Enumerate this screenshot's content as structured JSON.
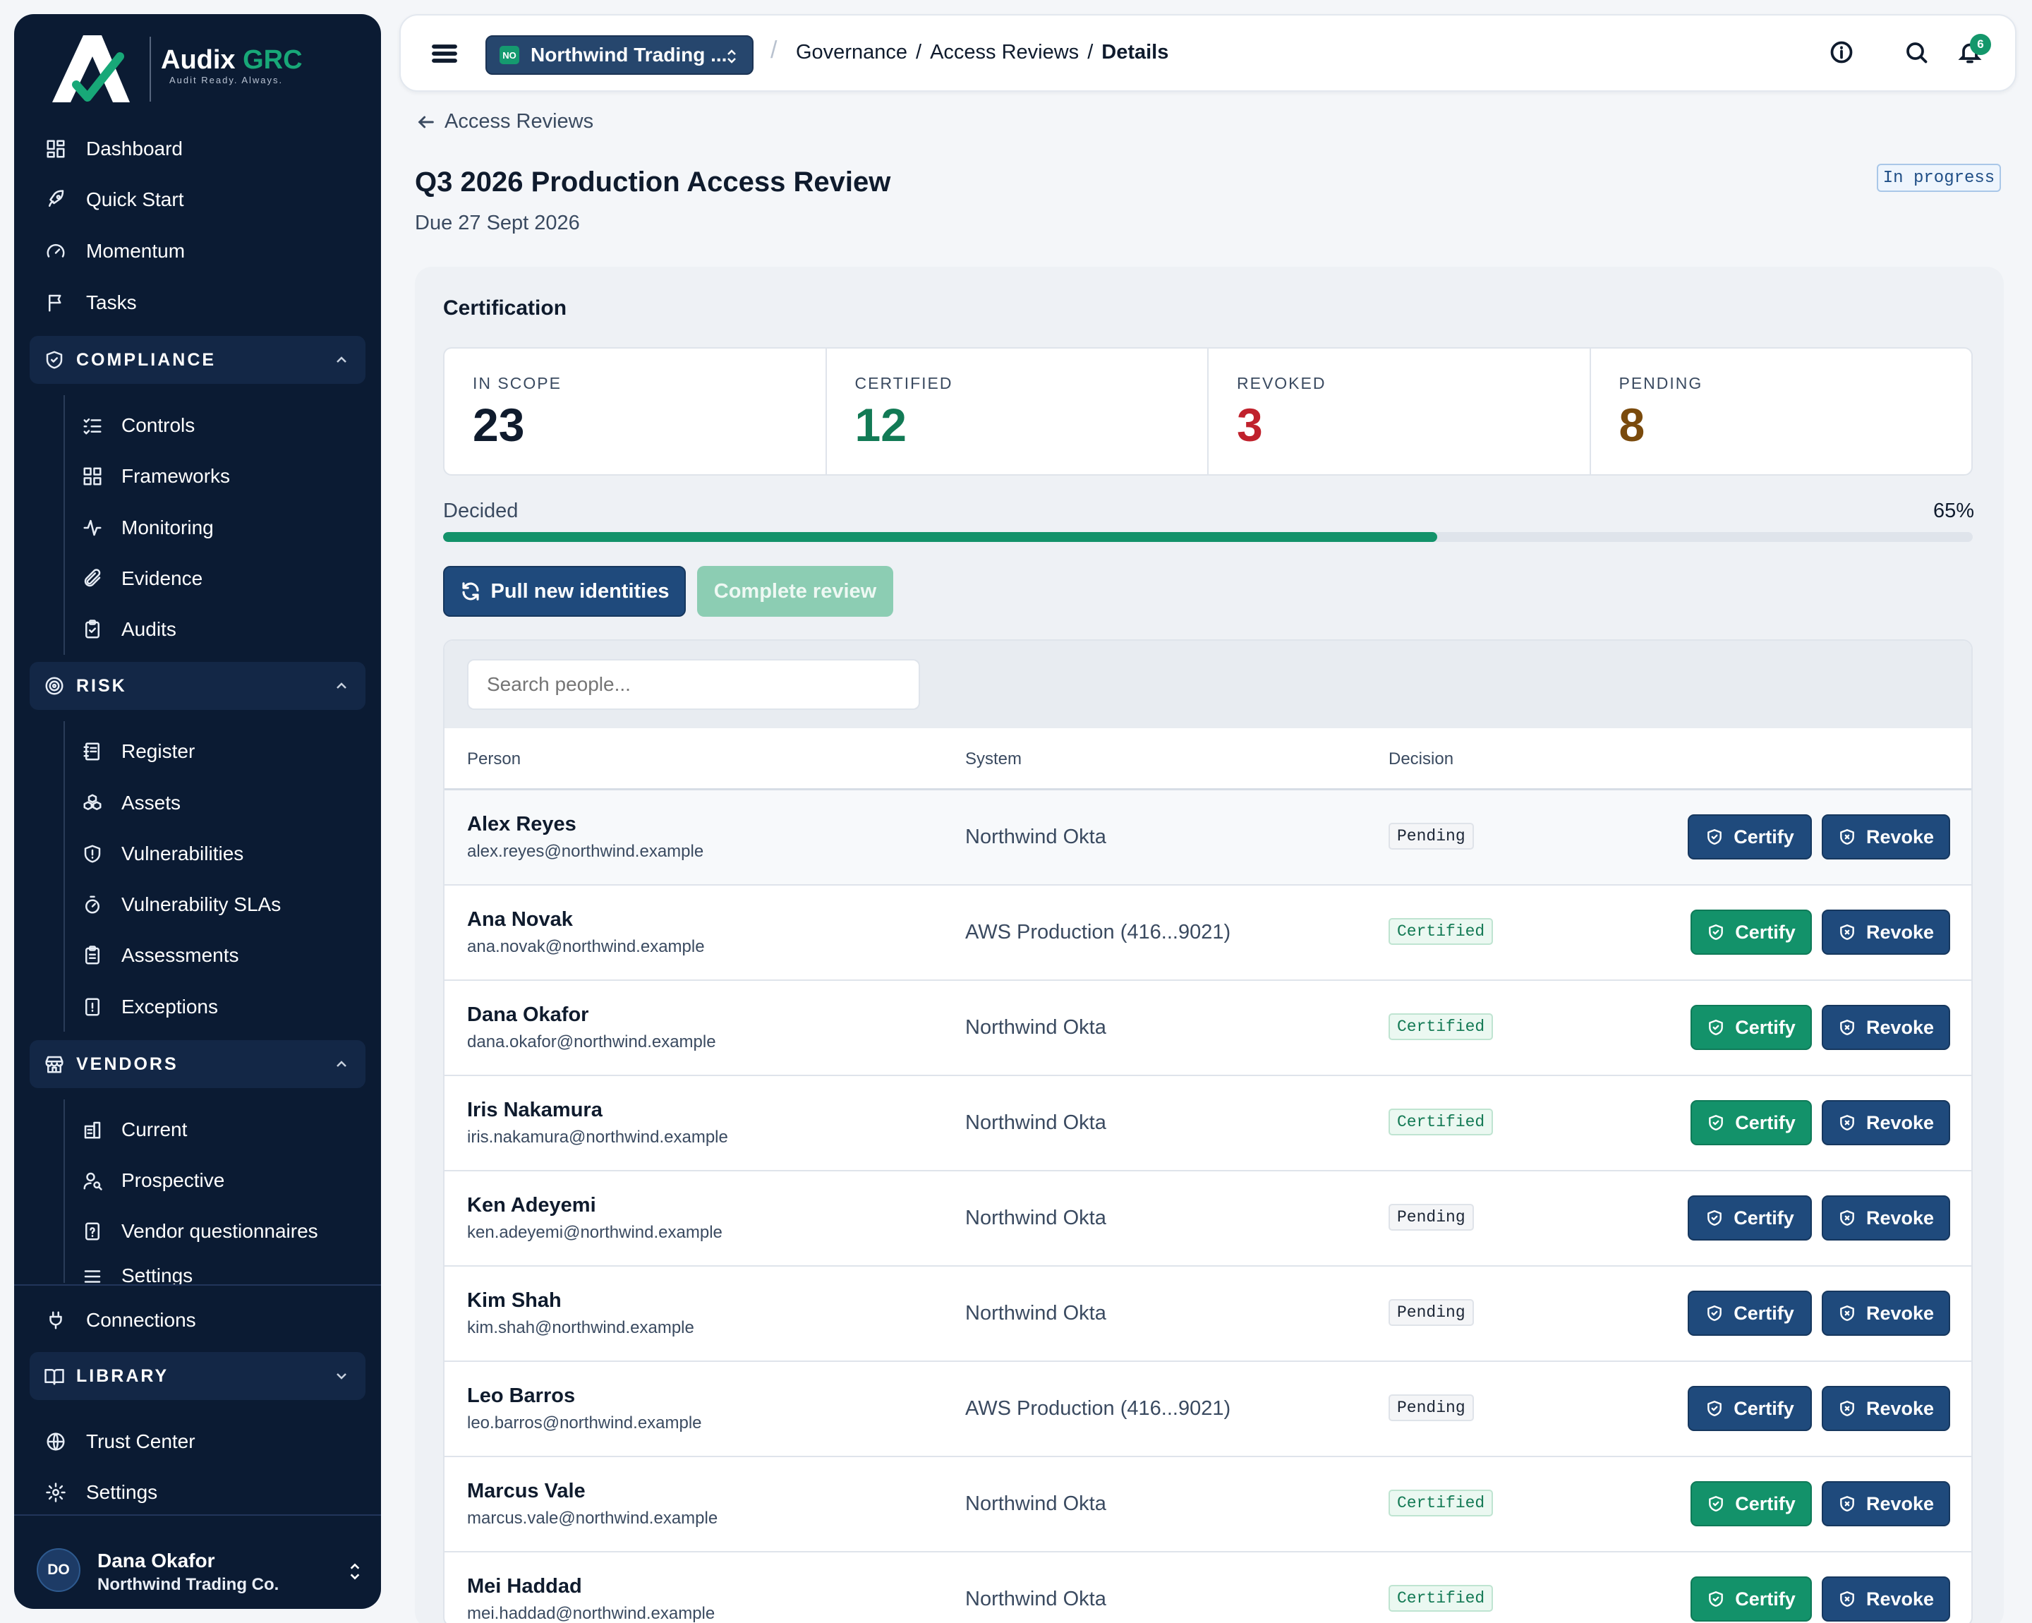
{
  "brand": {
    "name_main": "Audix",
    "name_accent": "GRC",
    "tagline": "Audit Ready. Always."
  },
  "sidebar": {
    "top_items": [
      {
        "label": "Dashboard",
        "icon": "dashboard-icon"
      },
      {
        "label": "Quick Start",
        "icon": "rocket-icon"
      },
      {
        "label": "Momentum",
        "icon": "gauge-icon"
      },
      {
        "label": "Tasks",
        "icon": "flag-icon"
      }
    ],
    "compliance": {
      "label": "COMPLIANCE",
      "items": [
        "Controls",
        "Frameworks",
        "Monitoring",
        "Evidence",
        "Audits"
      ]
    },
    "risk": {
      "label": "RISK",
      "items": [
        "Register",
        "Assets",
        "Vulnerabilities",
        "Vulnerability SLAs",
        "Assessments",
        "Exceptions"
      ]
    },
    "vendors": {
      "label": "VENDORS",
      "items": [
        "Current",
        "Prospective",
        "Vendor questionnaires",
        "Settings"
      ]
    },
    "connections": "Connections",
    "library": {
      "label": "LIBRARY"
    },
    "trust_center": "Trust Center",
    "settings": "Settings",
    "profile": {
      "initials": "DO",
      "name": "Dana Okafor",
      "org": "Northwind Trading Co."
    }
  },
  "topbar": {
    "org_badge": "NO",
    "org_name": "Northwind Trading ...",
    "breadcrumb": [
      "Governance",
      "Access Reviews",
      "Details"
    ],
    "notification_count": "6"
  },
  "page": {
    "back_label": "Access Reviews",
    "title": "Q3 2026 Production Access Review",
    "due": "Due 27 Sept 2026",
    "status": "In progress"
  },
  "certification": {
    "title": "Certification",
    "stats": [
      {
        "label": "IN SCOPE",
        "value": "23",
        "color": "#0f1b2d"
      },
      {
        "label": "CERTIFIED",
        "value": "12",
        "color": "#127a55"
      },
      {
        "label": "REVOKED",
        "value": "3",
        "color": "#c0212c"
      },
      {
        "label": "PENDING",
        "value": "8",
        "color": "#7a4a0c"
      }
    ],
    "progress_label": "Decided",
    "progress_text": "65%",
    "progress_value": 0.65,
    "pull_button": "Pull new identities",
    "complete_button": "Complete review"
  },
  "table": {
    "search_placeholder": "Search people...",
    "columns": [
      "Person",
      "System",
      "Decision"
    ],
    "certify_label": "Certify",
    "revoke_label": "Revoke",
    "rows": [
      {
        "name": "Alex Reyes",
        "email": "alex.reyes@northwind.example",
        "system": "Northwind Okta",
        "decision": "Pending"
      },
      {
        "name": "Ana Novak",
        "email": "ana.novak@northwind.example",
        "system": "AWS Production (416...9021)",
        "decision": "Certified"
      },
      {
        "name": "Dana Okafor",
        "email": "dana.okafor@northwind.example",
        "system": "Northwind Okta",
        "decision": "Certified"
      },
      {
        "name": "Iris Nakamura",
        "email": "iris.nakamura@northwind.example",
        "system": "Northwind Okta",
        "decision": "Certified"
      },
      {
        "name": "Ken Adeyemi",
        "email": "ken.adeyemi@northwind.example",
        "system": "Northwind Okta",
        "decision": "Pending"
      },
      {
        "name": "Kim Shah",
        "email": "kim.shah@northwind.example",
        "system": "Northwind Okta",
        "decision": "Pending"
      },
      {
        "name": "Leo Barros",
        "email": "leo.barros@northwind.example",
        "system": "AWS Production (416...9021)",
        "decision": "Pending"
      },
      {
        "name": "Marcus Vale",
        "email": "marcus.vale@northwind.example",
        "system": "Northwind Okta",
        "decision": "Certified"
      },
      {
        "name": "Mei Haddad",
        "email": "mei.haddad@northwind.example",
        "system": "Northwind Okta",
        "decision": "Certified"
      }
    ]
  },
  "colors": {
    "navy": "#0b1b33",
    "accent_green": "#13926a",
    "button_blue": "#1f4a7c"
  }
}
